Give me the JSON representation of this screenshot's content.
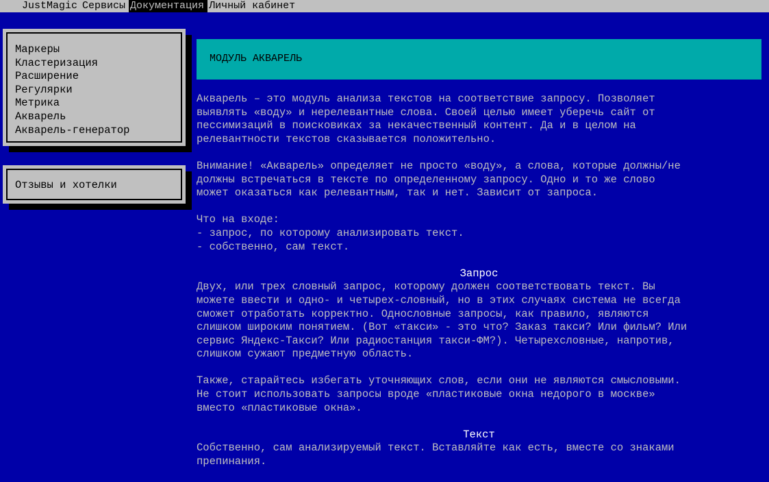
{
  "menubar": {
    "items": [
      "JustMagic",
      "Сервисы",
      "Документация",
      "Личный кабинет"
    ],
    "active_index": 2
  },
  "sidebar": {
    "items": [
      "Маркеры",
      "Кластеризация",
      "Расширение",
      "Регулярки",
      "Метрика",
      "Акварель",
      "Акварель-генератор"
    ],
    "feedback": "Отзывы и хотелки"
  },
  "page": {
    "title": "МОДУЛЬ АКВАРЕЛЬ",
    "intro": "Акварель – это модуль анализа текстов на соответствие запросу. Позволяет\nвыявлять «воду» и нерелевантные слова. Своей целью имеет уберечь сайт от\nпессимизаций в поисковиках за некачественный контент. Да и в целом на\nрелевантности текстов сказывается положительно.",
    "warning": "Внимание! «Акварель» определяет не просто «воду», а слова, которые должны/не\nдолжны встречаться в тексте по определенному запросу. Одно и то же слово\nможет оказаться как релевантным, так и нет. Зависит от запроса.",
    "input": "Что на входе:\n- запрос, по которому анализировать текст.\n- собственно, сам текст.",
    "query_heading": "Запрос",
    "query_text": "Двух, или трех словный запрос, которому должен соответствовать текст. Вы\nможете ввести и одно- и четырех-словный, но в этих случаях система не всегда\nсможет отработать корректно. Однословные запросы, как правило, являются\nслишком широким понятием. (Вот «такси» - это что? Заказ такси? Или фильм? Или\nсервис Яндекс-Такси? Или радиостанция такси-ФМ?). Четырехсловные, напротив,\nслишком сужают предметную область.",
    "query_text2": "Также, старайтесь избегать уточняющих слов, если они не являются смысловыми.\nНе стоит использовать запросы вроде «пластиковые окна недорого в москве»\nвместо «пластиковые окна».",
    "text_heading": "Текст",
    "text_text": "Собственно, сам анализируемый текст. Вставляйте как есть, вместе со знаками\nпрепинания."
  }
}
